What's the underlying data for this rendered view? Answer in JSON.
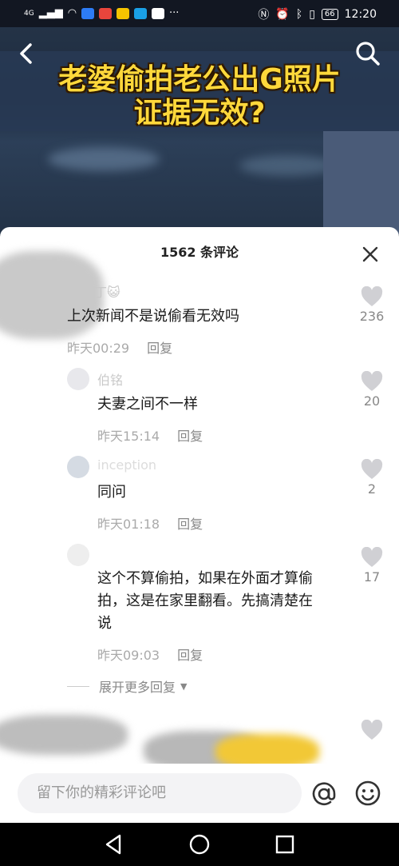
{
  "status_bar": {
    "network": "4G",
    "battery": "66",
    "time": "12:20",
    "more": "···"
  },
  "video": {
    "title_line1": "老婆偷拍老公出G照片",
    "title_line2": "证据无效?"
  },
  "sheet": {
    "title": "1562 条评论"
  },
  "comments": [
    {
      "username": "丁😺",
      "text": "上次新闻不是说偷看无效吗",
      "time": "昨天00:29",
      "reply": "回复",
      "likes": "236"
    },
    {
      "username": "伯铭",
      "text": "夫妻之间不一样",
      "time": "昨天15:14",
      "reply": "回复",
      "likes": "20"
    },
    {
      "username": "inception",
      "text": "同问",
      "time": "昨天01:18",
      "reply": "回复",
      "likes": "2"
    },
    {
      "username": "",
      "text_line1": "这个不算偷拍，如果在外面才算偷",
      "text_line2": "拍，这是在家里翻看。先搞清楚在",
      "text_line3": "说",
      "time": "昨天09:03",
      "reply": "回复",
      "likes": "17"
    }
  ],
  "expand": {
    "label": "展开更多回复"
  },
  "input": {
    "placeholder": "留下你的精彩评论吧"
  },
  "colors": {
    "accent_title": "#ffd83b",
    "heart": "#d0d0d4",
    "sheet_bg": "#ffffff"
  }
}
